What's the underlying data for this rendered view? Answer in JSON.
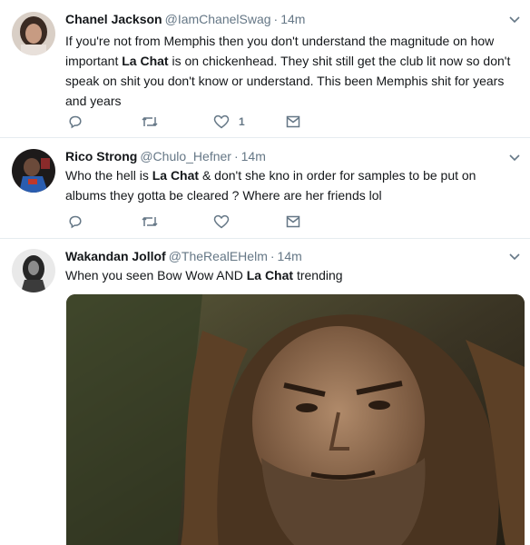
{
  "tweets": [
    {
      "fullname": "Chanel Jackson",
      "username": "@IamChanelSwag",
      "sep": "·",
      "time": "14m",
      "text_parts": [
        "If you're not from Memphis then you don't understand the magnitude on how important ",
        "La Chat",
        " is on chickenhead. They shit still get the club lit now so don't speak on shit you don't know or understand. This been Memphis shit for years and years"
      ],
      "likes": "1",
      "avatar_icon": "user-avatar",
      "actions": [
        "reply-icon",
        "retweet-icon",
        "heart-icon",
        "message-icon"
      ]
    },
    {
      "fullname": "Rico Strong",
      "username": "@Chulo_Hefner",
      "sep": "·",
      "time": "14m",
      "text_parts": [
        "Who the hell is ",
        "La Chat",
        " & don't she kno in order for samples to be put on albums they gotta be cleared ? Where are her friends lol"
      ],
      "likes": "",
      "avatar_icon": "user-avatar",
      "actions": [
        "reply-icon",
        "retweet-icon",
        "heart-icon",
        "message-icon"
      ]
    },
    {
      "fullname": "Wakandan Jollof",
      "username": "@TheRealEHelm",
      "sep": "·",
      "time": "14m",
      "text_parts": [
        "When you seen Bow Wow AND ",
        "La Chat",
        " trending"
      ],
      "avatar_icon": "user-avatar",
      "media": "gif-image"
    }
  ],
  "colors": {
    "text": "#14171a",
    "secondary": "#657786",
    "border": "#e6ecf0"
  }
}
